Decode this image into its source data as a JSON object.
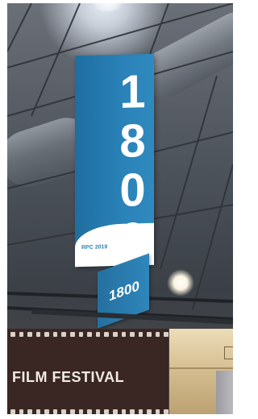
{
  "hanging_banner": {
    "number": "1800",
    "logo_text": "RPC 2019",
    "color": "#2a82b8"
  },
  "small_sign": {
    "number": "1800"
  },
  "festival_sign": {
    "text": "FILM FESTIVAL",
    "background": "#3a2622"
  },
  "scene": {
    "description_tags": [
      "convention-hall",
      "ceiling",
      "lights"
    ]
  }
}
